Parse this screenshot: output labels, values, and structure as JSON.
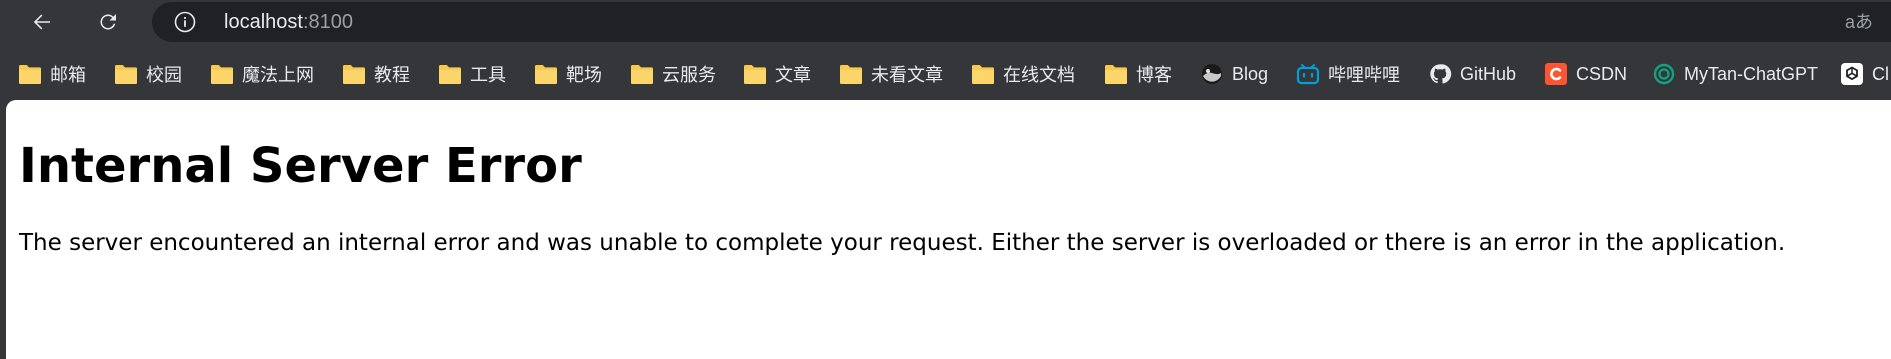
{
  "toolbar": {
    "back_icon": "arrow-left-icon",
    "reload_icon": "reload-icon",
    "info_icon": "info-icon",
    "url_host": "localhost",
    "url_port": ":8100",
    "translate_label": "aあ"
  },
  "bookmarks": [
    {
      "label": "邮箱",
      "icon": "folder-icon"
    },
    {
      "label": "校园",
      "icon": "folder-icon"
    },
    {
      "label": "魔法上网",
      "icon": "folder-icon"
    },
    {
      "label": "教程",
      "icon": "folder-icon"
    },
    {
      "label": "工具",
      "icon": "folder-icon"
    },
    {
      "label": "靶场",
      "icon": "folder-icon"
    },
    {
      "label": "云服务",
      "icon": "folder-icon"
    },
    {
      "label": "文章",
      "icon": "folder-icon"
    },
    {
      "label": "未看文章",
      "icon": "folder-icon"
    },
    {
      "label": "在线文档",
      "icon": "folder-icon"
    },
    {
      "label": "博客",
      "icon": "folder-icon"
    },
    {
      "label": "Blog",
      "icon": "blog-avatar-icon"
    },
    {
      "label": "哔哩哔哩",
      "icon": "bilibili-icon"
    },
    {
      "label": "GitHub",
      "icon": "github-icon"
    },
    {
      "label": "CSDN",
      "icon": "csdn-icon"
    },
    {
      "label": "MyTan-ChatGPT",
      "icon": "chatgpt-icon"
    },
    {
      "label": "Cl",
      "icon": "openai-icon"
    }
  ],
  "page": {
    "title": "Internal Server Error",
    "message": "The server encountered an internal error and was unable to complete your request. Either the server is overloaded or there is an error in the application."
  },
  "colors": {
    "toolbar_bg": "#35363a",
    "omnibox_bg": "#202124",
    "folder_yellow": "#f8c851",
    "bilibili_blue": "#00a1d6",
    "csdn_red": "#fc5531",
    "chatgpt_teal": "#10a37f"
  }
}
